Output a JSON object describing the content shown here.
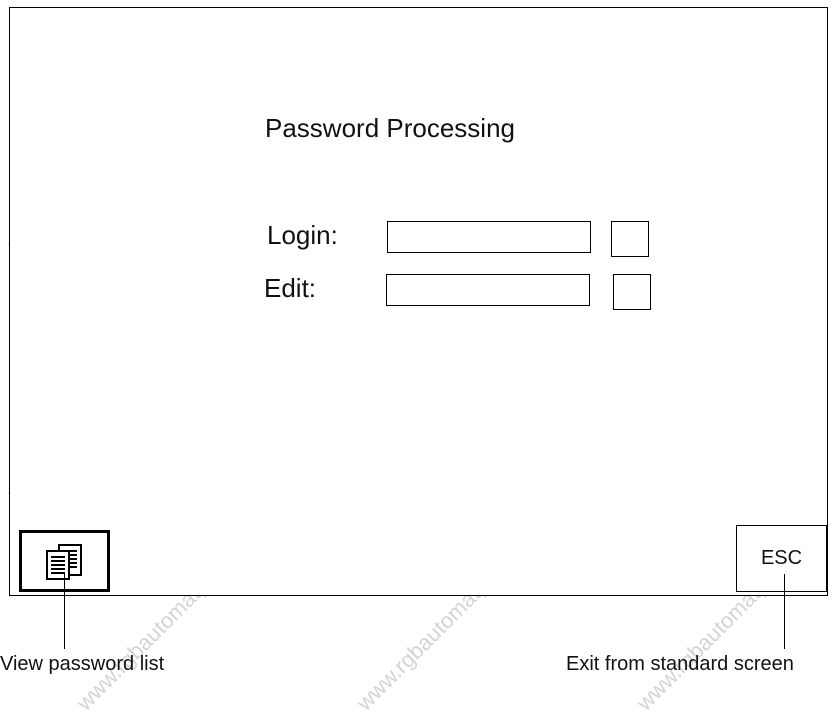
{
  "screen": {
    "title": "Password Processing",
    "login_label": "Login:",
    "edit_label": "Edit:",
    "login_value": "",
    "edit_value": ""
  },
  "buttons": {
    "view_list_icon": "password-list-icon",
    "esc_label": "ESC"
  },
  "captions": {
    "view_password_list": "View password list",
    "exit_standard_screen": "Exit from standard screen"
  },
  "watermark": "www.rgbautomatyka.pl"
}
